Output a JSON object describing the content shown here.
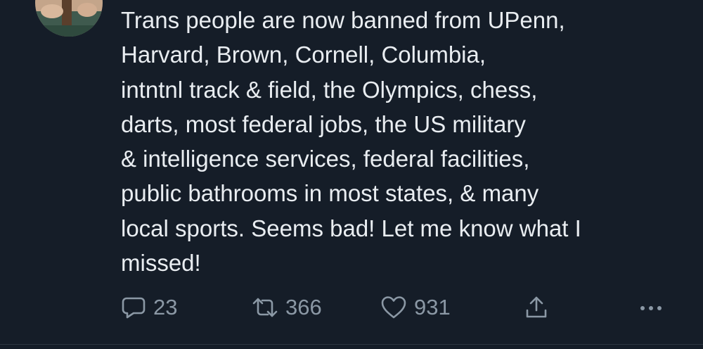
{
  "tweet": {
    "text_lines": [
      "Trans people are now banned from UPenn,",
      "Harvard, Brown, Cornell, Columbia,",
      "intntnl track & field, the Olympics, chess,",
      "darts, most federal jobs, the US military",
      "& intelligence services, federal facilities,",
      "public bathrooms in most states, & many",
      "local sports. Seems bad! Let me know what I",
      "missed!"
    ]
  },
  "actions": {
    "replies": "23",
    "retweets": "366",
    "likes": "931"
  },
  "icons": {
    "reply": "reply-bubble-icon",
    "retweet": "retweet-icon",
    "like": "heart-icon",
    "share": "share-icon",
    "more": "more-dots-icon"
  },
  "colors": {
    "background": "#151d28",
    "text": "#e9edf1",
    "muted": "#8b98a5"
  }
}
